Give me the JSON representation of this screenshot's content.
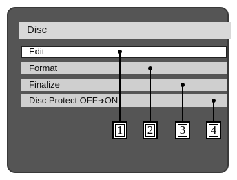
{
  "window": {
    "title": "Disc"
  },
  "menu": {
    "items": [
      {
        "label": "Edit",
        "selected": true
      },
      {
        "label": "Format",
        "selected": false
      },
      {
        "label": "Finalize",
        "selected": false
      },
      {
        "label_before": "Disc Protect OFF",
        "arrow_glyph": "➜",
        "label_after": "ON",
        "selected": false
      }
    ]
  },
  "callouts": [
    {
      "number": "1"
    },
    {
      "number": "2"
    },
    {
      "number": "3"
    },
    {
      "number": "4"
    }
  ]
}
